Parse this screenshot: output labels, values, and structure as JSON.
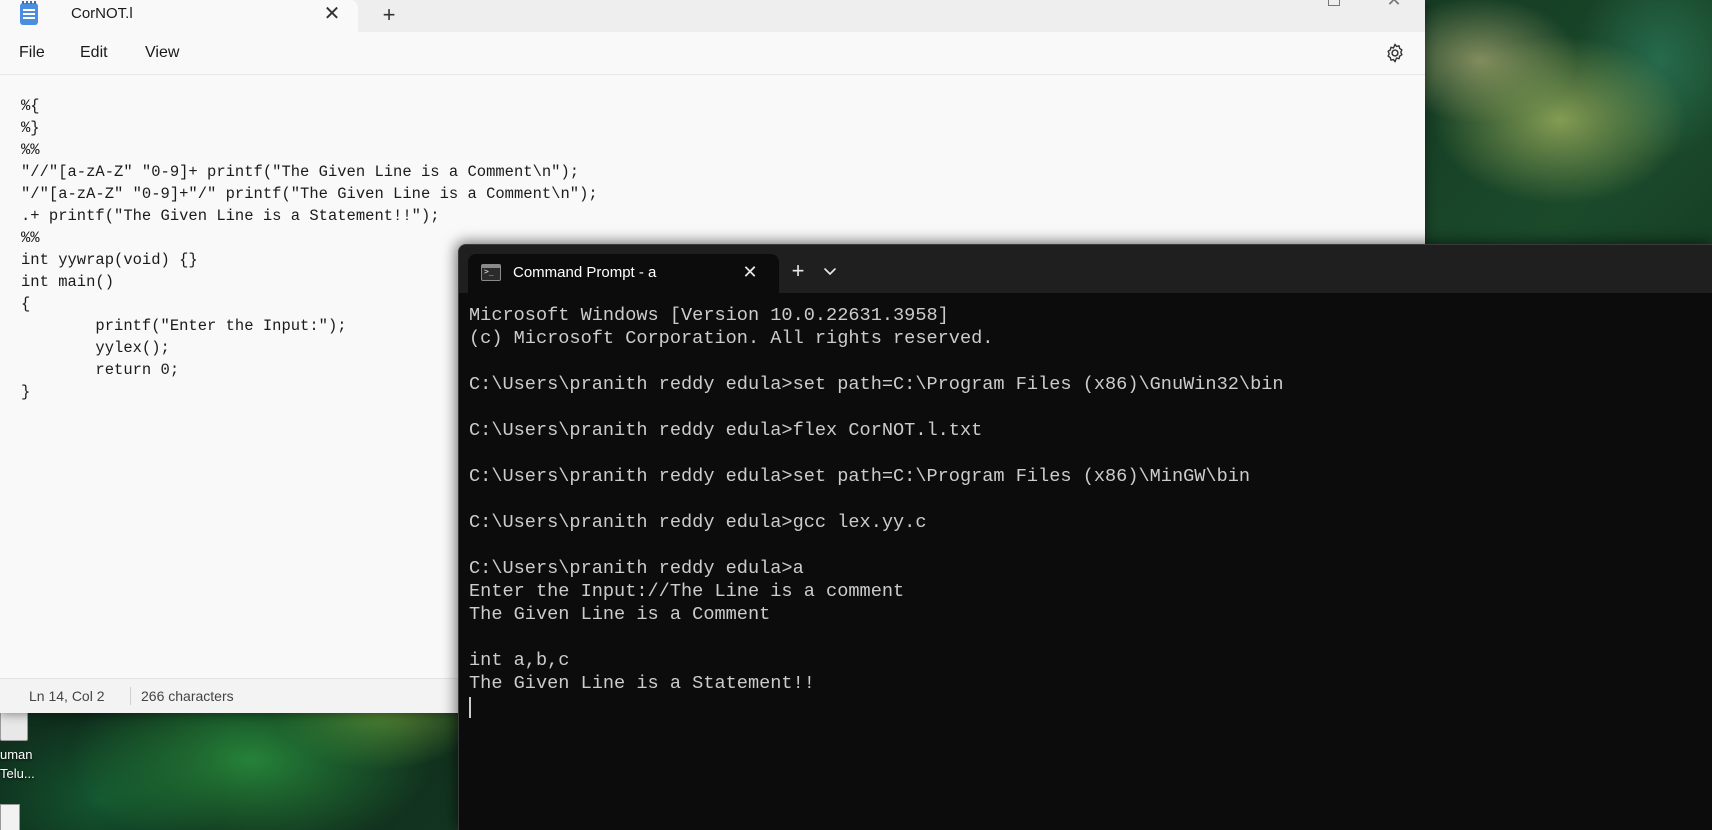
{
  "notepad": {
    "tab_title": "CorNOT.l",
    "tab_close_glyph": "✕",
    "new_tab_glyph": "+",
    "window_close_glyph": "✕",
    "menu": {
      "file": "File",
      "edit": "Edit",
      "view": "View"
    },
    "settings_icon": "gear-icon",
    "content": "%{\n%}\n%%\n\"//\"[a-zA-Z\" \"0-9]+ printf(\"The Given Line is a Comment\\n\");\n\"/\"[a-zA-Z\" \"0-9]+\"/\" printf(\"The Given Line is a Comment\\n\");\n.+ printf(\"The Given Line is a Statement!!\");\n%%\nint yywrap(void) {}\nint main()\n{\n        printf(\"Enter the Input:\");\n        yylex();\n        return 0;\n}",
    "status": {
      "position": "Ln 14, Col 2",
      "characters": "266 characters"
    }
  },
  "terminal": {
    "tab_title": "Command Prompt - a",
    "tab_close_glyph": "✕",
    "new_tab_glyph": "+",
    "dropdown_icon": "chevron-down-icon",
    "output": "Microsoft Windows [Version 10.0.22631.3958]\n(c) Microsoft Corporation. All rights reserved.\n\nC:\\Users\\pranith reddy edula>set path=C:\\Program Files (x86)\\GnuWin32\\bin\n\nC:\\Users\\pranith reddy edula>flex CorNOT.l.txt\n\nC:\\Users\\pranith reddy edula>set path=C:\\Program Files (x86)\\MinGW\\bin\n\nC:\\Users\\pranith reddy edula>gcc lex.yy.c\n\nC:\\Users\\pranith reddy edula>a\nEnter the Input://The Line is a comment\nThe Given Line is a Comment\n\nint a,b,c\nThe Given Line is a Statement!!"
  },
  "desktop": {
    "icon_label_line1": "uman",
    "icon_label_line2": "Telu..."
  },
  "colors": {
    "notepad_bg": "#f9f9f9",
    "terminal_bg": "#0c0c0c",
    "terminal_text": "#cccccc"
  }
}
